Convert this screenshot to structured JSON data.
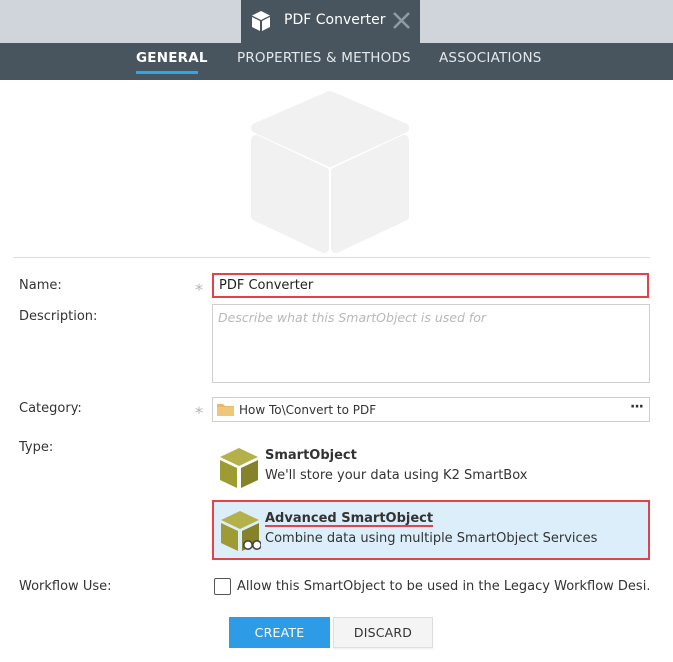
{
  "window": {
    "tab_title": "PDF Converter",
    "tab_icon": "smartobject-cube-icon",
    "close_icon": "close-icon"
  },
  "nav": {
    "tabs": [
      {
        "label": "GENERAL",
        "active": true
      },
      {
        "label": "PROPERTIES & METHODS",
        "active": false
      },
      {
        "label": "ASSOCIATIONS",
        "active": false
      }
    ],
    "active_underline_color": "#2ea7e6"
  },
  "form": {
    "name": {
      "label": "Name:",
      "value": "PDF Converter",
      "required": true,
      "required_mark": "*"
    },
    "description": {
      "label": "Description:",
      "value": "",
      "placeholder": "Describe what this SmartObject is used for"
    },
    "category": {
      "label": "Category:",
      "value": "How To\\Convert to PDF",
      "required": true,
      "required_mark": "*",
      "browse_label": "···"
    },
    "type": {
      "label": "Type:",
      "options": [
        {
          "title": "SmartObject",
          "description": "We'll store your data using K2 SmartBox",
          "selected": false,
          "icon": "smartobject-icon"
        },
        {
          "title": "Advanced SmartObject",
          "description": "Combine data using multiple SmartObject Services",
          "selected": true,
          "icon": "advanced-smartobject-icon"
        }
      ]
    },
    "workflow": {
      "label": "Workflow Use:",
      "checkbox_label": "Allow this SmartObject to be used in the Legacy Workflow Desi...",
      "checked": false
    }
  },
  "actions": {
    "create_label": "CREATE",
    "discard_label": "DISCARD"
  },
  "colors": {
    "header_dark": "#48555e",
    "header_light": "#cfd5db",
    "accent_blue": "#2e9be6",
    "highlight_red": "#e2434b",
    "selected_bg": "#ddeefb",
    "cube_olive": "#9e9a34"
  }
}
